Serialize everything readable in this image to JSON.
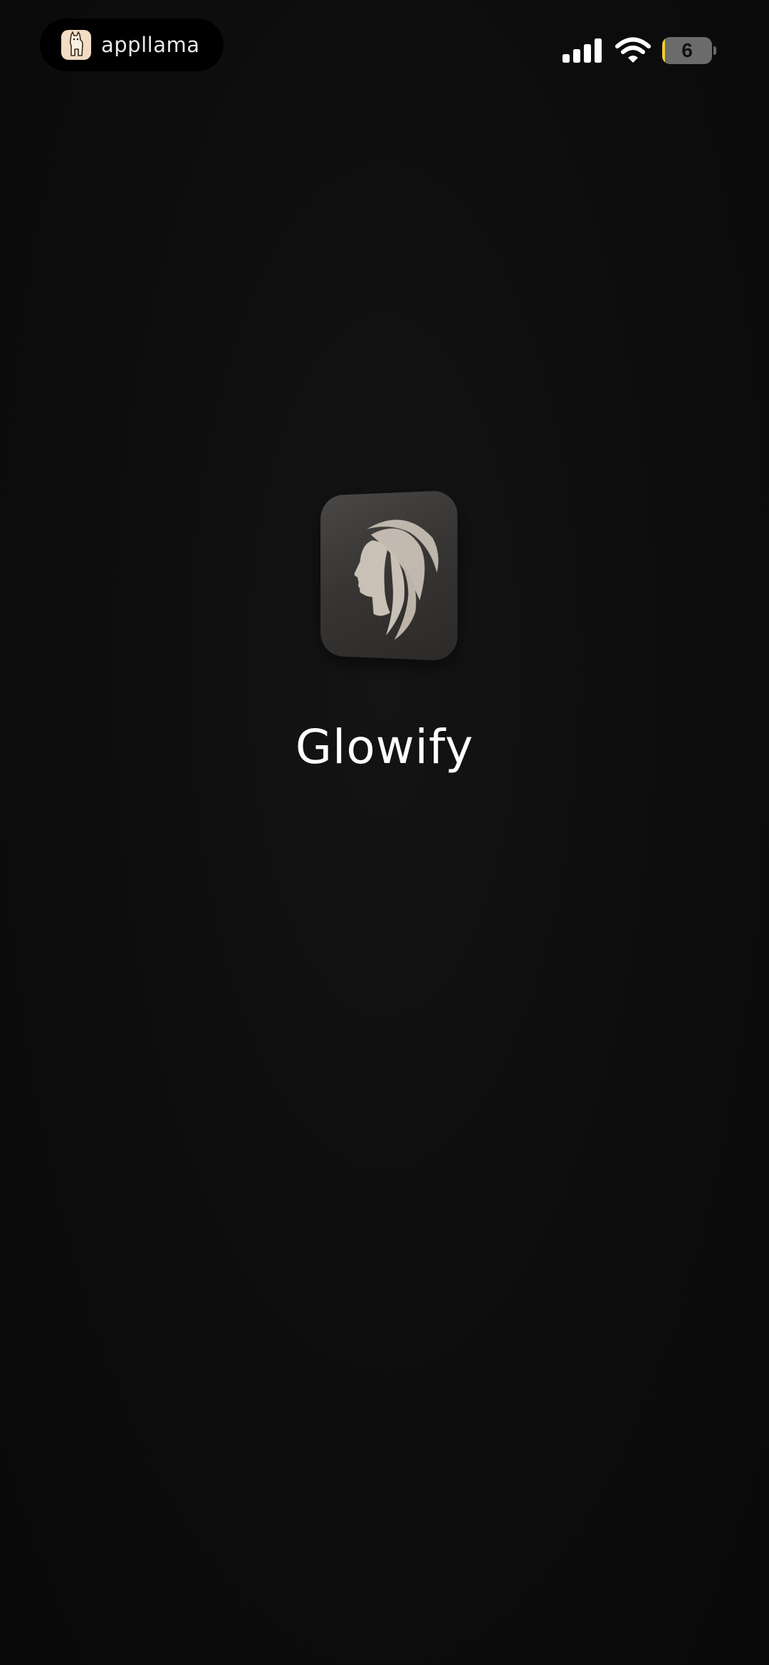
{
  "status_bar": {
    "watermark_text": "appllama",
    "battery_level": "6",
    "battery_fraction": 0.06,
    "battery_fill_color": "#f1cc35",
    "signal_bars": 4,
    "icons": [
      "llama-logo-icon",
      "cellular-signal-icon",
      "wifi-icon",
      "battery-icon"
    ]
  },
  "splash": {
    "app_icon": "woman-profile-hair-icon",
    "app_name": "Glowify"
  },
  "colors": {
    "background": "#0c0c0c",
    "icon_bg": "#3a3836",
    "icon_figure": "#c9c1b6",
    "text": "#ffffff"
  }
}
